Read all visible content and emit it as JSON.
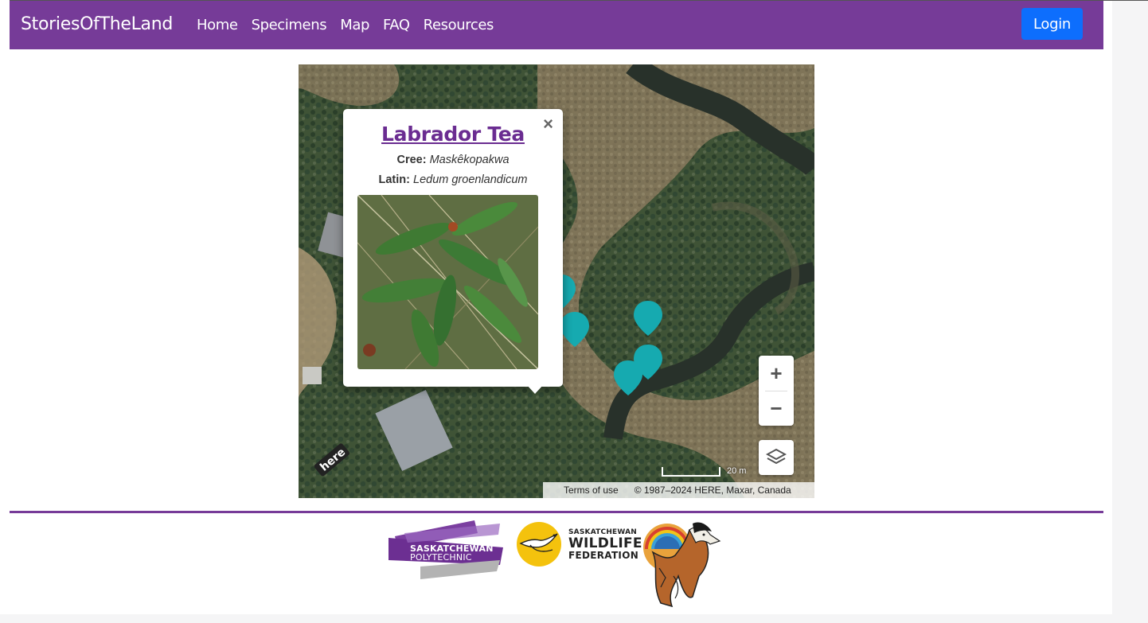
{
  "navbar": {
    "brand": "StoriesOfTheLand",
    "links": [
      "Home",
      "Specimens",
      "Map",
      "FAQ",
      "Resources"
    ],
    "login_label": "Login",
    "color": "#763b98",
    "login_color": "#0d6efd"
  },
  "map": {
    "popup": {
      "title": "Labrador Tea",
      "cree_label": "Cree:",
      "cree_name": "Maskêkopakwa",
      "latin_label": "Latin:",
      "latin_name": "Ledum groenlandicum",
      "close_symbol": "×"
    },
    "marker_color": "#16aab0",
    "zoom_in": "+",
    "zoom_out": "−",
    "scale_label": "20 m",
    "terms": "Terms of use",
    "copyright": "© 1987–2024 HERE, Maxar, Canada",
    "provider_logo": "here"
  },
  "footer": {
    "logos": [
      {
        "name": "saskatchewan-polytechnic",
        "line1": "SASKATCHEWAN",
        "line2": "POLYTECHNIC"
      },
      {
        "name": "saskatchewan-wildlife-federation",
        "line1": "SASKATCHEWAN",
        "line2": "WILDLIFE",
        "line3": "FEDERATION"
      },
      {
        "name": "first-nations-emblem"
      }
    ]
  }
}
